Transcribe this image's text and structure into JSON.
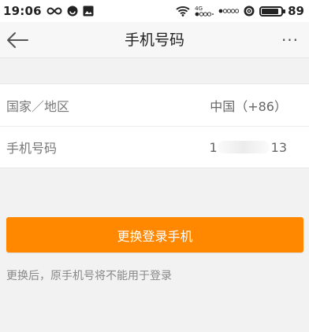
{
  "status_bar": {
    "time": "19:06",
    "network_label": "4G",
    "battery_percent_text": "89",
    "battery_level": 0.89,
    "icons": [
      "infinity-icon",
      "circle-app-icon",
      "image-app-icon",
      "wifi-icon",
      "signal-icon",
      "signal-icon-2",
      "hd-voice-icon",
      "battery-icon"
    ]
  },
  "header": {
    "title": "手机号码",
    "back_icon": "arrow-left-icon",
    "more_icon": "more-dots-icon",
    "more_text": "···"
  },
  "rows": [
    {
      "label": "国家／地区",
      "value": "中国（+86）"
    },
    {
      "label": "手机号码",
      "value_prefix": "1",
      "value_suffix": "13"
    }
  ],
  "primary_button": {
    "label": "更换登录手机",
    "color": "#ff8800"
  },
  "hint": {
    "text": "更换后，原手机号将不能用于登录"
  }
}
